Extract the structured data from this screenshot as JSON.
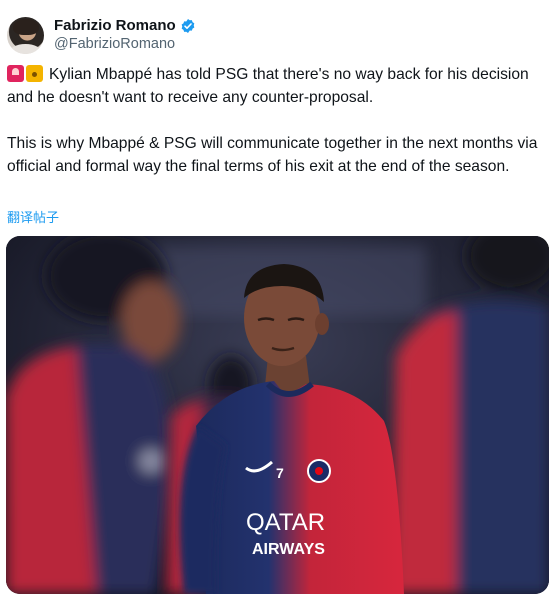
{
  "author": {
    "display_name": "Fabrizio Romano",
    "handle": "@FabrizioRomano",
    "verified": true
  },
  "tweet": {
    "paragraph_1": "Kylian Mbappé has told PSG that there's no way back for his decision and he doesn't want to receive any counter-proposal.",
    "paragraph_2": "This is why Mbappé & PSG will communicate together in the next months via official and formal way the final terms of his exit at the end of the season.",
    "leading_emojis": [
      "siren-emoji",
      "lock-emoji"
    ]
  },
  "translate_link": "翻译帖子",
  "media": {
    "kit_number": "7",
    "sponsor_line1": "QATAR",
    "sponsor_line2": "AIRWAYS"
  },
  "colors": {
    "accent": "#1d9bf0",
    "text": "#0f1419",
    "secondary_text": "#536471",
    "kit_navy": "#1c2a5c",
    "kit_red": "#d7263d"
  }
}
